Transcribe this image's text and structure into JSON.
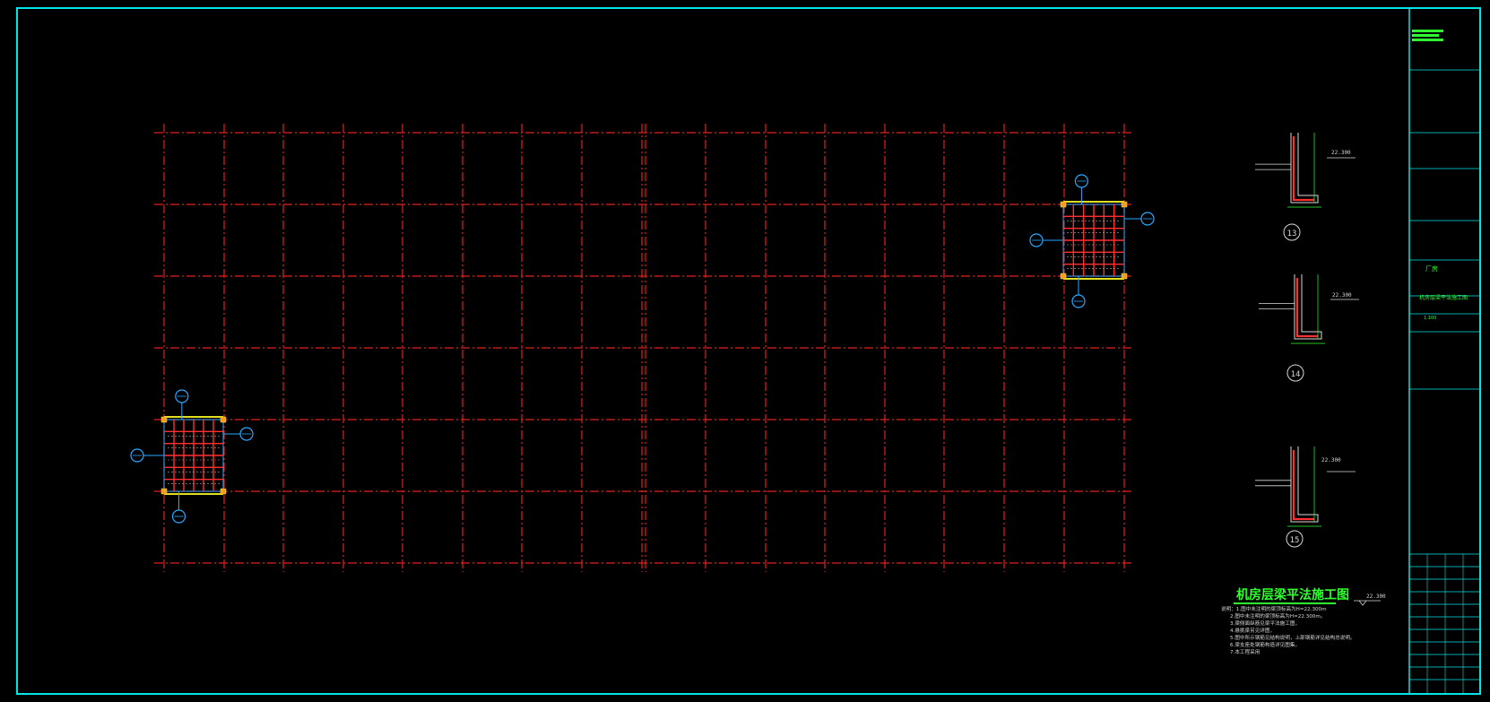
{
  "sheet": {
    "background": "#000000",
    "frame_color": "#00e5e5",
    "grid_color": "#e0201e",
    "column_color": "#ff2b2b",
    "rebar_color": "#ff3030",
    "axis_bubble_color": "#2aa9ff",
    "title_color": "#30ff30",
    "detail_line_color": "#d8d8d8"
  },
  "title": {
    "text": "机房层梁平法施工图",
    "elevation": "22.300"
  },
  "notes": [
    "说明：1.图中未注明的梁顶标高为H=22.300m",
    "2.图中未注明的梁顶标高为H=22.300m。",
    "3.梁侧面纵筋见梁平法施工图，",
    "4.悬挑梁另见详图，",
    "5.图中所示钢筋见结构说明，上部钢筋详见结构总说明。",
    "6.梁支座处钢筋构造详见图集。",
    "7.本工程采用"
  ],
  "details": [
    {
      "id": "13",
      "elevation": "22.300"
    },
    {
      "id": "14",
      "elevation": "22.300"
    },
    {
      "id": "15",
      "elevation": "22.300"
    }
  ],
  "title_block": {
    "project_label": "厂房",
    "drawing_name": "机房层梁平法施工图",
    "scale_label": "1:100"
  },
  "stair_plans": [
    {
      "name": "upper-right",
      "bubbles": [
        "",
        "",
        "",
        ""
      ]
    },
    {
      "name": "lower-left",
      "bubbles": [
        "",
        "",
        "",
        ""
      ]
    }
  ]
}
